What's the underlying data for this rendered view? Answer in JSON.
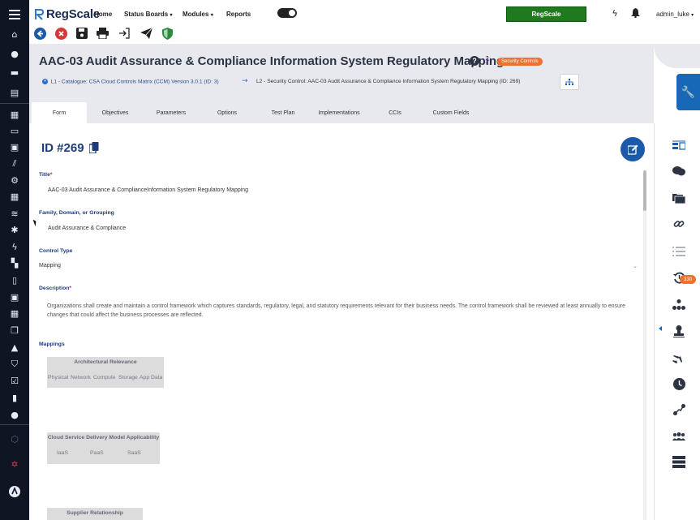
{
  "app": {
    "brand_name": "RegScale",
    "accent": "#1a5aa8",
    "sidebar_bg": "#0f1523",
    "header_bg": "#e8e9ef",
    "badge_color": "#f07030"
  },
  "topnav": {
    "items": [
      "Home",
      "Status Boards",
      "Modules",
      "Reports"
    ],
    "status_boards_chevron": "▾",
    "modules_chevron": "▾",
    "brand_button": "RegScale",
    "user": "admin_luke",
    "user_chevron": "▾"
  },
  "toolbar": {
    "icons": [
      "back-icon",
      "cancel-icon",
      "save-icon",
      "print-icon",
      "export-icon",
      "send-icon",
      "shield-icon"
    ]
  },
  "header": {
    "title": "AAC-03 Audit Assurance & Compliance Information System Regulatory Mapping",
    "badge": "Security Controls",
    "breadcrumb_l1": "L1 - Catalogue: CSA Cloud Controls Matrix (CCM) Version 3.0.1 (ID: 3)",
    "breadcrumb_l2": "L2 - Security Control: AAC-03 Audit Assurance & Compliance Information System Regulatory Mapping (ID: 269)"
  },
  "tabs": [
    {
      "label": "Form",
      "active": true
    },
    {
      "label": "Objectives",
      "active": false
    },
    {
      "label": "Parameters",
      "active": false
    },
    {
      "label": "Options",
      "active": false
    },
    {
      "label": "Test Plan",
      "active": false
    },
    {
      "label": "Implementations",
      "active": false
    },
    {
      "label": "CCIs",
      "active": false
    },
    {
      "label": "Custom Fields",
      "active": false
    }
  ],
  "form": {
    "id_label": "ID #269",
    "title_label": "Title",
    "title_required": "*",
    "title_value": "AAC-03 Audit Assurance & ComplianceInformation System Regulatory Mapping",
    "family_label": "Family, Domain, or Grouping",
    "family_value": "Audit Assurance & Compliance",
    "control_type_label": "Control Type",
    "control_type_value": "Mapping",
    "description_label": "Description",
    "description_required": "*",
    "description_value": "Organizations shall create and maintain a control framework which captures standards, regulatory, legal, and statutory requirements relevant for their business needs. The control framework shall be reviewed at least annually to ensure changes that could affect the business processes are reflected.",
    "mappings_label": "Mappings"
  },
  "mappings": {
    "architectural": {
      "header": "Architectural Relevance",
      "columns": [
        "Physical",
        "Network",
        "Compute",
        "Storage",
        "App",
        "Data"
      ]
    },
    "cloud": {
      "header": "Cloud Service Delivery Model Applicability",
      "columns": [
        "IaaS",
        "PaaS",
        "SaaS"
      ]
    },
    "supplier": {
      "header": "Supplier Relationship"
    }
  },
  "right_rail": {
    "history_badge": "330"
  }
}
